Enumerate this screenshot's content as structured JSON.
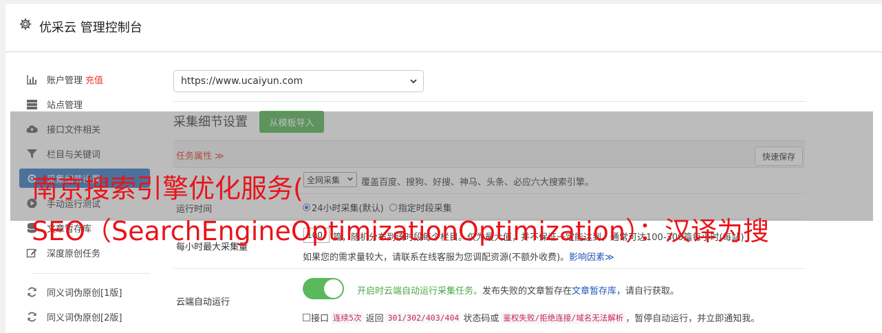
{
  "header": {
    "title": "优采云 管理控制台",
    "icon": "gear-icon"
  },
  "sidebar": {
    "items": [
      {
        "label": "账户管理",
        "extra": "充值",
        "icon": "bar-chart-icon"
      },
      {
        "label": "站点管理",
        "icon": "server-icon"
      },
      {
        "label": "接口文件相关",
        "icon": "cloud-upload-icon"
      },
      {
        "label": "栏目与关键词",
        "icon": "filter-icon"
      },
      {
        "label": "采集细节设置",
        "icon": "gears-icon"
      },
      {
        "label": "手动运行测试",
        "icon": "play-circle-icon"
      },
      {
        "label": "文章暂存库",
        "icon": "database-icon"
      },
      {
        "label": "深度原创任务",
        "icon": "edit-icon"
      },
      {
        "label": "同义词伪原创[1版]",
        "icon": "refresh-icon"
      },
      {
        "label": "同义词伪原创[2版]",
        "icon": "refresh-icon"
      }
    ]
  },
  "site_select": {
    "value": "https://www.ucaiyun.com"
  },
  "detail": {
    "title": "采集细节设置",
    "import_button": "从模板导入",
    "task_attr": "任务属性 ≫",
    "quick_save": "快速保存"
  },
  "rows": {
    "engine": {
      "select_value": "全网采集",
      "desc": "覆盖百度、搜狗、好搜、神马、头条、必应六大搜索引擎。"
    },
    "runtime": {
      "label": "运行时间",
      "opt1": "24小时采集(默认)",
      "opt2": "指定时段采集"
    },
    "max_per_hour": {
      "label": "每小时最大采集量",
      "value": "100",
      "desc": "篇，随机分布到该时段每个栏目。仅为最大值，并不保证一定能达到，通常可达100-300篇每小时(每站)",
      "desc2": "如果您的需求量较大，请联系在线客服为您调配资源(不额外收费)。",
      "link": "影响因素≫"
    },
    "cloud": {
      "label": "云端自动运行",
      "toggle_on": true,
      "desc_green": "开启时云端自动运行采集任务。",
      "desc_mid": "发布失败的文章暂存在",
      "desc_link": "文章暂存库",
      "desc_end": "，请自行获取。",
      "check_label": "接口",
      "code1": "连续5次",
      "text2": "返回",
      "code2": "301/302/403/404",
      "text3": "状态码或",
      "code3": "鉴权失败/拒绝连接/域名无法解析",
      "text4": "，暂停自动运行，并立即通知我。"
    }
  },
  "watermark": {
    "line1": "南京搜索引擎优化服务(",
    "line2": "SEO（SearchEngineOptimizationOptimization）：汉译为搜"
  },
  "colors": {
    "accent": "#3d7ec9",
    "green": "#5cb85c",
    "red": "#e43b2a",
    "watermark": "#e8141a"
  }
}
